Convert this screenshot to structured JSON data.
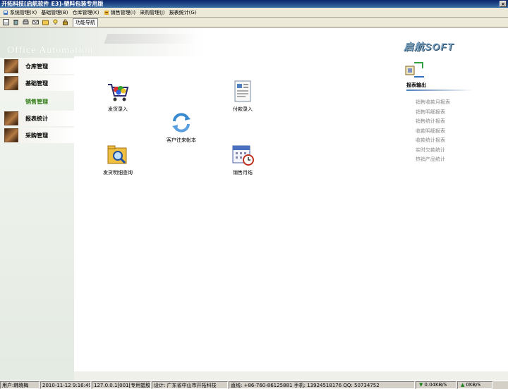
{
  "window": {
    "title": "开拓科技[启航软件 E3]-塑料包装专用版",
    "close_glyph": "×"
  },
  "menu": [
    {
      "label": "系统管理(X)",
      "icon": "system-icon"
    },
    {
      "label": "基础管理(B)",
      "icon": ""
    },
    {
      "label": "仓库管理(K)",
      "icon": ""
    },
    {
      "label": "销售管理(I)",
      "icon": "sales-icon"
    },
    {
      "label": "采购管理(J)",
      "icon": ""
    },
    {
      "label": "报表统计(G)",
      "icon": ""
    }
  ],
  "toolbar": {
    "buttons": [
      "save-icon",
      "trash-icon",
      "print-icon",
      "mail-icon",
      "folder-icon",
      "bulb-icon",
      "lock-icon"
    ],
    "nav_tab": "功能导航"
  },
  "left_panel": {
    "bg_text": "Office Automation",
    "items": [
      {
        "label": "仓库管理",
        "active": false
      },
      {
        "label": "基础管理",
        "active": false
      },
      {
        "label": "销售管理",
        "active": true
      },
      {
        "label": "报表统计",
        "active": false
      },
      {
        "label": "采购管理",
        "active": false
      }
    ]
  },
  "features": {
    "shipping_entry": "发货录入",
    "payment_entry": "付款录入",
    "customer_ledger": "客户往来帐本",
    "shipping_detail_query": "发货明细查询",
    "monthly_sales_close": "销售月结"
  },
  "right_panel": {
    "logo": "启航SOFT",
    "report_title": "报表输出",
    "reports": [
      "销售收款月报表",
      "销售明细报表",
      "销售统计报表",
      "收款明细报表",
      "收款统计报表",
      "实时欠款统计",
      "热销产品统计"
    ]
  },
  "status": {
    "user": "用户:韩晓梅",
    "datetime": "2010-11-12 9:16:49",
    "server": "127.0.0.1[001[专用塑胶]",
    "design": "设计: 广东省中山市开拓科技",
    "contact": "直线: +86-760-86125881  手机: 13924518176 QQ: 50734752",
    "download": "0.04KB/S",
    "upload": "0KB/S"
  },
  "colors": {
    "accent": "#2f7c14",
    "titlebar": "#0a246a",
    "report_gray": "#888888"
  }
}
